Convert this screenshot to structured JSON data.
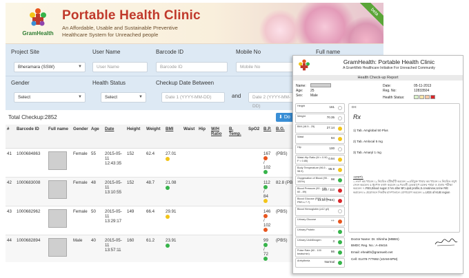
{
  "header": {
    "brand": "GramHealth",
    "title": "Portable Health Clinic",
    "subtitle_line1": "An Affordable, Usable and Sustainable Preventive",
    "subtitle_line2": "Healthcare System for Unreached people",
    "badge": "beta"
  },
  "filters": {
    "project_site_label": "Project Site",
    "project_site_value": "Bheramara (SSW)",
    "user_name_label": "User Name",
    "user_name_placeholder": "User Name",
    "barcode_label": "Barcode ID",
    "barcode_placeholder": "Barcode ID",
    "mobile_label": "Mobile No",
    "mobile_placeholder": "Mobile No",
    "fullname_label": "Full name",
    "gender_label": "Gender",
    "gender_value": "Select",
    "health_status_label": "Health Status",
    "health_status_value": "Select",
    "date_label": "Checkup Date Between",
    "date_from_placeholder": "Date 1 (YYYY-MM-DD)",
    "and_label": "and",
    "date_to_placeholder": "Date 2 (YYYY-MM-DD)"
  },
  "summary": {
    "total": "Total Checkup:2852",
    "download_label": "Do"
  },
  "table": {
    "headers": [
      "#",
      "Barcode ID",
      "Full name",
      "Gender",
      "Age",
      "Date",
      "Height",
      "Weight",
      "BMI",
      "Waist",
      "Hip",
      "W/H Ratio",
      "B. Temp.",
      "SpO2",
      "B.P.",
      "B.G."
    ],
    "rows": [
      {
        "num": "41",
        "barcode": "1000684863",
        "gender": "Female",
        "age": "55",
        "date": "2015-05-11 12:43:35",
        "height": "152",
        "weight": "62.4",
        "bmi": "27.01",
        "bmi_color": "#f2c418",
        "bp_sys": "167",
        "bp_dia": "102",
        "bp_top_color": "#e8551e",
        "bp_bottom_color": "#36b44a",
        "bg": "(PBS)"
      },
      {
        "num": "42",
        "barcode": "1000683008",
        "gender": "Female",
        "age": "48",
        "date": "2015-05-11 13:10:55",
        "height": "152",
        "weight": "48.7",
        "bmi": "21.08",
        "bmi_color": "#36b44a",
        "bp_sys": "112",
        "bp_dia": "84",
        "bp_top_color": "#36b44a",
        "bp_bottom_color": "#f2c418",
        "bg": "82.8 (PBS)"
      },
      {
        "num": "43",
        "barcode": "1000682962",
        "gender": "Female",
        "age": "50",
        "date": "2015-05-11 13:29:17",
        "height": "149",
        "weight": "66.4",
        "bmi": "29.91",
        "bmi_color": "#f2c418",
        "bp_sys": "146",
        "bp_dia": "102",
        "bp_top_color": "#e8551e",
        "bp_bottom_color": "#e8551e",
        "bg": "(PBS)"
      },
      {
        "num": "44",
        "barcode": "1000682894",
        "gender": "Male",
        "age": "40",
        "date": "2015-05-11 13:57:11",
        "height": "160",
        "weight": "61.2",
        "bmi": "23.91",
        "bmi_color": "#36b44a",
        "bp_sys": "99",
        "bp_dia": "72",
        "bp_top_color": "#36b44a",
        "bp_bottom_color": "#36b44a",
        "bg": "(PBS)"
      }
    ]
  },
  "report": {
    "title": "GramHealth: Portable Health Clinic",
    "subtitle": "A GramWeb Healthcare Initiative For Unreached Community",
    "band": "Health Check-up Report",
    "name_label": "Name:",
    "age_label": "Age:",
    "age_value": "25",
    "sex_label": "Sex:",
    "sex_value": "Male",
    "date_label": "Date:",
    "date_value": "05-11-2013",
    "reg_label": "Reg. No:",
    "reg_value": "12833504",
    "health_status_label": "Health Status:",
    "vitals": [
      {
        "name": "Height",
        "value": "161",
        "color": "#ffffff"
      },
      {
        "name": "Weight",
        "value": "70.35",
        "color": "#ffffff"
      },
      {
        "name": "BMI (18.5 - 25)",
        "value": "27.14",
        "color": "#f2c418"
      },
      {
        "name": "Waist",
        "value": "94",
        "color": "#f2c418"
      },
      {
        "name": "Hip",
        "value": "100",
        "color": "#ffffff"
      },
      {
        "name": "Waist-Hip Ratio (M < 0.90, F < 0.85)",
        "value": "0.94",
        "color": "#f2c418"
      },
      {
        "name": "Body Temperature (96.5 - 98.9)",
        "value": "95.9",
        "color": "#f2c418"
      },
      {
        "name": "Oxygenation of Blood (95 - 100%)",
        "value": "98",
        "color": "#36b44a"
      },
      {
        "name": "Blood Pressure (90 - 139, 60 - 89)",
        "value": "160 / 113",
        "color": "#d9262a"
      },
      {
        "name": "Blood Glucose (FBS ≤ 5.5, PBS ≤ 7.7)",
        "value": "13.33 (PBS)",
        "color": "#d9262a"
      },
      {
        "name": "Blood Hemoglobin (≥12 g/l)",
        "value": "",
        "color": "#ffffff"
      },
      {
        "name": "Urinary Glucose",
        "value": "++",
        "color": "#e8551e"
      },
      {
        "name": "Urinary Protein",
        "value": "-",
        "color": "#36b44a"
      },
      {
        "name": "Urinary Urobilinogen",
        "value": "3",
        "color": "#36b44a"
      },
      {
        "name": "Pulse Rate (60 - 100 beats/min)",
        "value": "86",
        "color": "#36b44a"
      },
      {
        "name": "Arrhythmia",
        "value": "Normal",
        "color": "#36b44a"
      }
    ],
    "dx_label": "DX:",
    "rx_symbol": "Rx",
    "meds": [
      "1) Tab. Amglobal 50 Plus",
      "2) Tab. Amlocal 5 mg",
      "3) Tab. Amaryl 1 mg"
    ],
    "advice_label": "পরামর্শঃ",
    "advice_text": "১.লবণ কম খাবেন। ২.নিয়মিত হাঁটাহাঁটি করবেন। ৩.চর্বিযুক্ত খাবার কম খাবেন। ৪.নিয়মিত ওষুধ সেবন করবেন। ৫.ধূমপান বর্জন করবেন। ৬.পরবর্তী চেকআপে রক্তের শর্করা ও প্রস্রাব পরীক্ষা করবেন। ৭.FBS,Blood sugar 2 hrs after BF,Lipid profile,S.creatinine,Urine R/E করাবেন। ৮.প্রয়োজনে নিকটস্থ হাসপাতালে যোগাযোগ করবেন। ৯.UGS of KUB region",
    "doctor_name": "Doctor Name: Dr. Shimha (MBBS)",
    "bmdc": "BMDC Reg. No.: A-49416",
    "email": "Email: ehealth@gramweb.net",
    "cell": "Cell: 01478-777692 (10AM-6PM)",
    "status_colors": [
      "#d8f0c8",
      "#f7e3a8",
      "#f6c9a8",
      "#d9262a"
    ]
  },
  "colors": {
    "green": "#36b44a",
    "yellow": "#f2c418",
    "orange": "#e8551e",
    "red": "#d9262a",
    "accent_blue": "#3a8fd6"
  }
}
